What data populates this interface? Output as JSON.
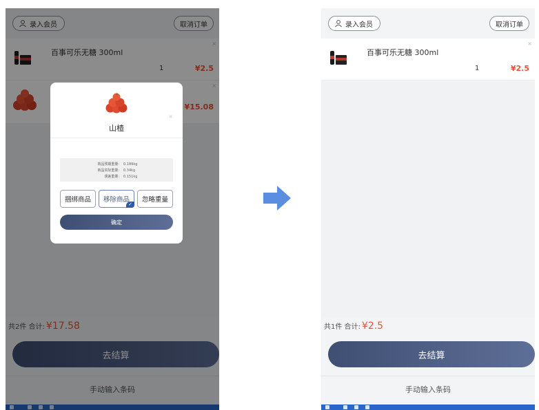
{
  "left": {
    "member_label": "录入会员",
    "cancel_label": "取消订单",
    "items": [
      {
        "name": "百事可乐无糖 300ml",
        "qty": "1",
        "price": "¥2.5",
        "close": "×"
      },
      {
        "name": "",
        "qty": "",
        "price": "¥15.08",
        "close": "×"
      }
    ],
    "total_label": "共2件 合计:",
    "total_amount": "¥17.58",
    "checkout_label": "去结算",
    "manual_label": "手动输入条码",
    "modal": {
      "product_name": "山楂",
      "close": "×",
      "weights": [
        {
          "label": "商品预期重量:",
          "value": "0.189kg"
        },
        {
          "label": "商品实际重量:",
          "value": "0.34kg"
        },
        {
          "label": "误差重量:",
          "value": "0.151kg"
        }
      ],
      "actions": [
        {
          "label": "捆绑商品",
          "selected": false
        },
        {
          "label": "移除商品",
          "selected": true
        },
        {
          "label": "忽略重量",
          "selected": false
        }
      ],
      "check_mark": "✓",
      "confirm_label": "确定"
    }
  },
  "right": {
    "member_label": "录入会员",
    "cancel_label": "取消订单",
    "items": [
      {
        "name": "百事可乐无糖 300ml",
        "qty": "1",
        "price": "¥2.5",
        "close": "×"
      }
    ],
    "total_label": "共1件 合计:",
    "total_amount": "¥2.5",
    "checkout_label": "去结算",
    "manual_label": "手动输入条码"
  },
  "colors": {
    "accent_price": "#e8543a",
    "button_dark": "#3f4f73",
    "arrow": "#5b8ee0",
    "nav_bar": "#2a66c9"
  }
}
